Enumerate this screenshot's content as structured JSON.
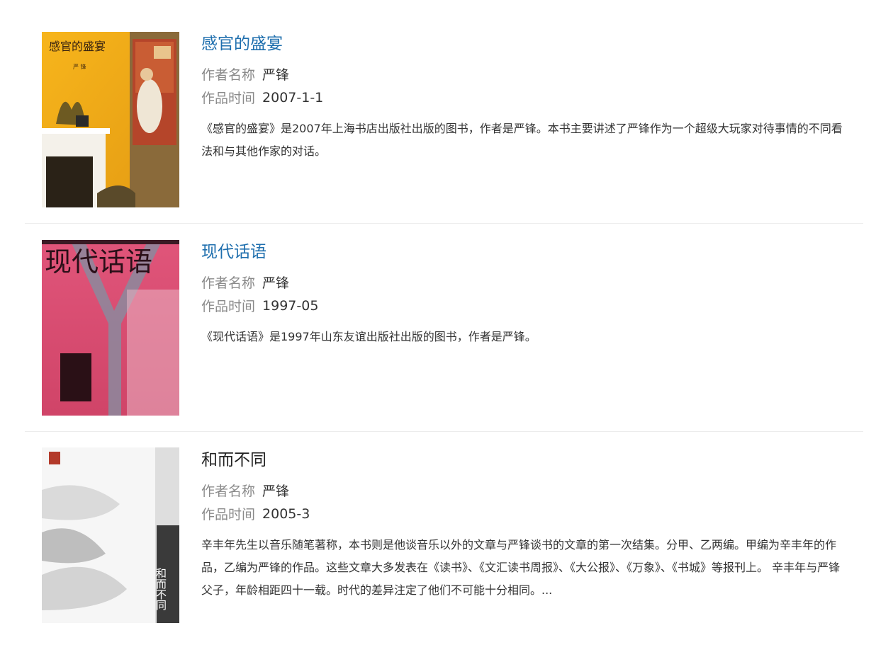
{
  "labels": {
    "author": "作者名称",
    "time": "作品时间"
  },
  "works": [
    {
      "title": "感官的盛宴",
      "author": "严锋",
      "time": "2007-1-1",
      "description": "《感官的盛宴》是2007年上海书店出版社出版的图书，作者是严锋。本书主要讲述了严锋作为一个超级大玩家对待事情的不同看法和与其他作家的对话。",
      "title_link": true,
      "cover_text": "感官的盛宴",
      "cover_author": "严 锋"
    },
    {
      "title": "现代话语",
      "author": "严锋",
      "time": "1997-05",
      "description": "《现代话语》是1997年山东友谊出版社出版的图书，作者是严锋。",
      "title_link": true,
      "cover_text": "现代话语"
    },
    {
      "title": "和而不同",
      "author": "严锋",
      "time": "2005-3",
      "description": "辛丰年先生以音乐随笔著称，本书则是他谈音乐以外的文章与严锋谈书的文章的第一次结集。分甲、乙两编。甲编为辛丰年的作品，乙编为严锋的作品。这些文章大多发表在《读书》、《文汇读书周报》、《大公报》、《万象》、《书城》等报刊上。 辛丰年与严锋父子，年龄相距四十一载。时代的差异注定了他们不可能十分相同。...",
      "title_link": false,
      "cover_text": "和而不同"
    }
  ],
  "colors": {
    "link": "#1f6fae",
    "label": "#8a8a8a",
    "text": "#333333",
    "divider": "#ececec"
  }
}
